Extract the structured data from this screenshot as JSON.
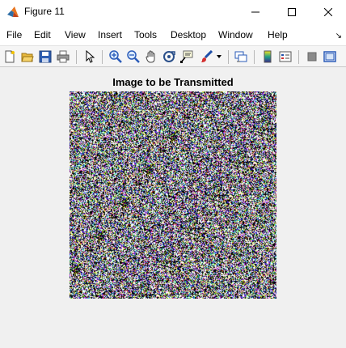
{
  "window": {
    "title": "Figure 11",
    "app_icon": "matlab-icon",
    "controls": [
      "minimize-icon",
      "maximize-icon",
      "close-icon"
    ]
  },
  "menubar": {
    "items": [
      "File",
      "Edit",
      "View",
      "Insert",
      "Tools",
      "Desktop",
      "Window",
      "Help"
    ],
    "dock_glyph": "↘"
  },
  "toolbar": {
    "buttons": [
      "new-figure-icon",
      "open-file-icon",
      "save-icon",
      "print-icon",
      "pointer-icon",
      "zoom-in-icon",
      "zoom-out-icon",
      "pan-icon",
      "rotate-3d-icon",
      "data-cursor-icon",
      "brush-icon",
      "link-plot-icon",
      "insert-colorbar-icon",
      "insert-legend-icon",
      "hide-plot-tools-icon",
      "show-plot-tools-icon"
    ]
  },
  "axes": {
    "title": "Image to be Transmitted",
    "content": "noise-image",
    "palette": [
      "#ffffff",
      "#000000",
      "#2b2bd4",
      "#d4d42b",
      "#d42bd4",
      "#2bd4d4",
      "#7f7f7f",
      "#d42b2b",
      "#2bd42b"
    ]
  }
}
